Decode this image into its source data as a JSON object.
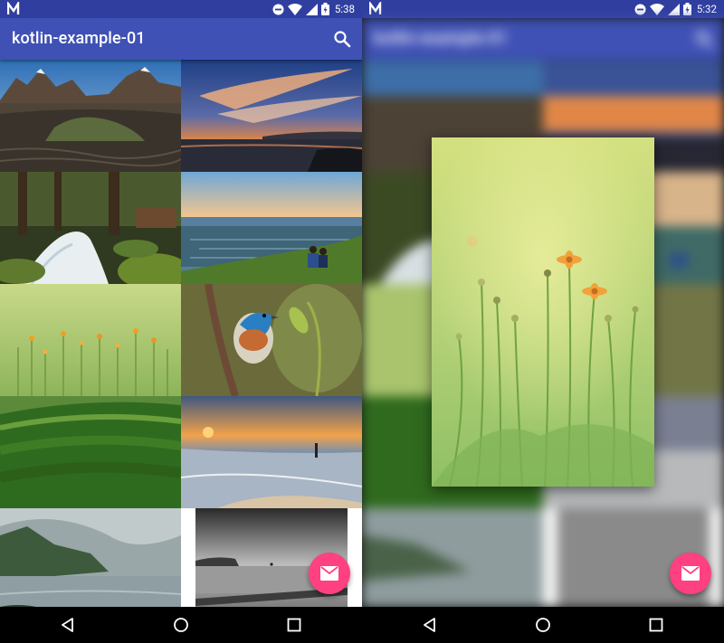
{
  "screens": {
    "left": {
      "status_time": "5:38",
      "app_title": "kotlin-example-01"
    },
    "right": {
      "status_time": "5:32",
      "app_title": "kotlin-example-01"
    }
  },
  "icons": {
    "status": [
      "n-logo-icon",
      "dnd-icon",
      "wifi-icon",
      "signal-icon",
      "battery-icon"
    ],
    "toolbar": [
      "search-icon"
    ],
    "fab": "email-icon",
    "nav": [
      "back-icon",
      "home-icon",
      "recents-icon"
    ]
  },
  "photos": [
    "mountain-beach",
    "sunset-sea",
    "forest-waterfall",
    "city-view-couple",
    "yellow-flowers",
    "blue-bird",
    "green-field",
    "beach-sunset-person",
    "foggy-cliffs",
    "black-white-pier"
  ],
  "preview_photo": "yellow-flowers",
  "colors": {
    "status_bar": "#303f9f",
    "app_bar": "#3f51b5",
    "fab": "#ff4081",
    "nav_bar": "#000000"
  }
}
